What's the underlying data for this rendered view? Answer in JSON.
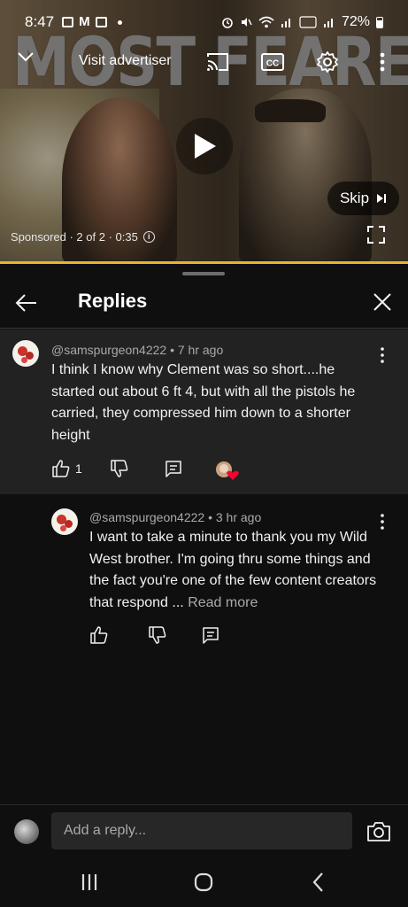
{
  "status_bar": {
    "time": "8:47",
    "battery": "72%"
  },
  "video": {
    "title_overlay": "MOST FEARED",
    "visit_advertiser": "Visit advertiser",
    "skip_label": "Skip",
    "sponsored_text": "Sponsored · 2 of 2 · 0:35",
    "progress_color": "#e8b52a"
  },
  "panel": {
    "title": "Replies"
  },
  "comments": [
    {
      "author": "@samspurgeon4222 • 7 hr ago",
      "text": "I think I know why Clement was so short....he started out about 6 ft 4, but with all the pistols he carried, they compressed him down to a shorter height",
      "likes": "1"
    },
    {
      "author": "@samspurgeon4222 • 3 hr ago",
      "text": "I want to take a minute to thank you my Wild West brother. I'm going thru some things and the fact you're one of the few content creators that respond ... ",
      "read_more": "Read more"
    }
  ],
  "reply_bar": {
    "placeholder": "Add a reply..."
  },
  "icons": {
    "collapse": "chevron-down-icon",
    "cast": "cast-icon",
    "captions": "cc-icon",
    "settings": "gear-icon",
    "more": "more-vert-icon",
    "play": "play-icon",
    "skip": "skip-next-icon",
    "info": "info-icon",
    "fullscreen": "fullscreen-icon",
    "back": "arrow-left-icon",
    "close": "close-icon",
    "like": "thumbs-up-icon",
    "dislike": "thumbs-down-icon",
    "reply": "comment-icon",
    "camera": "camera-icon"
  }
}
